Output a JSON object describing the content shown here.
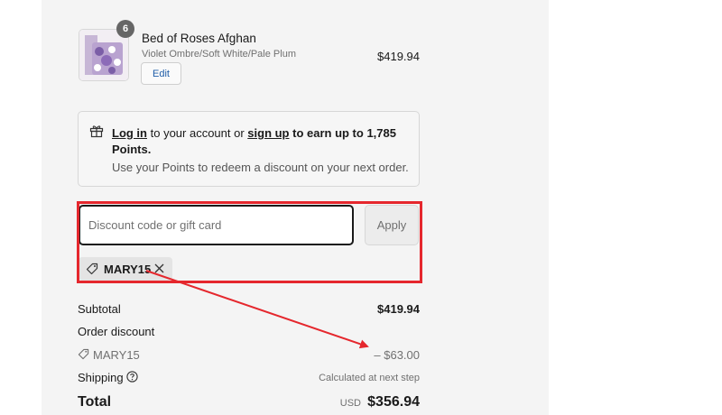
{
  "product": {
    "quantity": "6",
    "name": "Bed of Roses Afghan",
    "variant": "Violet Ombre/Soft White/Pale Plum",
    "edit_label": "Edit",
    "price": "$419.94"
  },
  "points": {
    "login_label": "Log in",
    "text_mid": " to your account or ",
    "signup_label": "sign up",
    "text_end": " to earn up to 1,785",
    "points_word": "Points.",
    "subtext": "Use your Points to redeem a discount on your next order."
  },
  "discount": {
    "placeholder": "Discount code or gift card",
    "apply_label": "Apply",
    "applied_code": "MARY15"
  },
  "summary": {
    "subtotal_label": "Subtotal",
    "subtotal_value": "$419.94",
    "order_discount_label": "Order discount",
    "discount_code": "MARY15",
    "discount_value": "– $63.00",
    "shipping_label": "Shipping",
    "shipping_value": "Calculated at next step",
    "total_label": "Total",
    "currency": "USD",
    "total_value": "$356.94"
  },
  "colors": {
    "annotation_red": "#e5272d",
    "link_blue": "#1f5da8"
  }
}
